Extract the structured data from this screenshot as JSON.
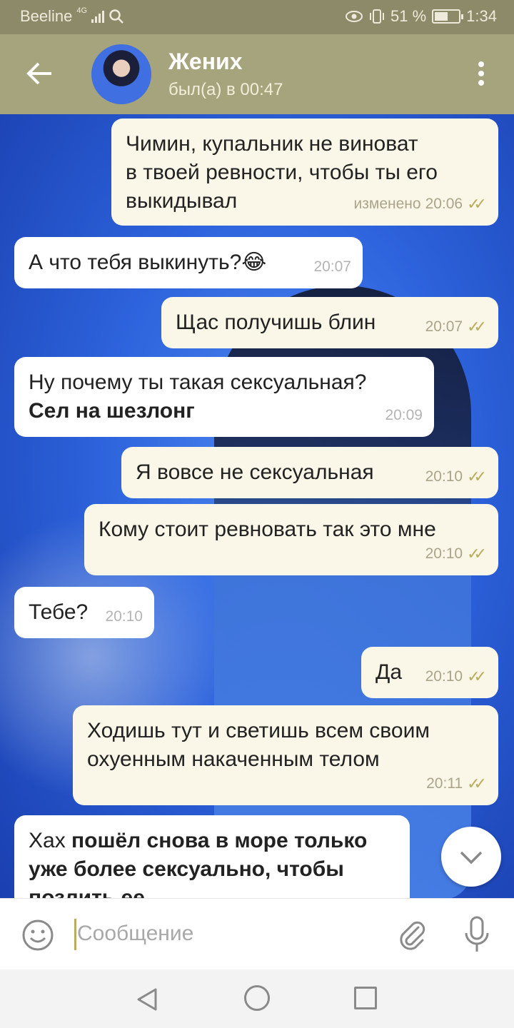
{
  "status_bar": {
    "carrier": "Beeline",
    "network": "4G",
    "battery": "51 %",
    "time": "1:34"
  },
  "header": {
    "contact_name": "Жених",
    "last_seen": "был(а) в 00:47"
  },
  "messages": [
    {
      "dir": "out",
      "lines": [
        "Чимин, купальник не виноват",
        "в твоей ревности, чтобы ты его",
        "выкидывал"
      ],
      "edited": "изменено",
      "time": "20:06",
      "read": true
    },
    {
      "dir": "in",
      "text": "А что тебя выкинуть?😂",
      "time": "20:07"
    },
    {
      "dir": "out",
      "text": "Щас получишь блин",
      "time": "20:07",
      "read": true
    },
    {
      "dir": "in",
      "text": "Ну почему ты такая сексуальная?",
      "bold_text": "Сел на шезлонг",
      "time": "20:09"
    },
    {
      "dir": "out",
      "text": "Я вовсе не сексуальная",
      "time": "20:10",
      "read": true
    },
    {
      "dir": "out",
      "text": "Кому стоит ревновать так это мне",
      "time": "20:10",
      "read": true
    },
    {
      "dir": "in",
      "text": "Тебе?",
      "time": "20:10"
    },
    {
      "dir": "out",
      "text": "Да",
      "time": "20:10",
      "read": true
    },
    {
      "dir": "out",
      "lines": [
        "Ходишь тут и светишь всем своим",
        "охуенным накаченным телом"
      ],
      "time": "20:11",
      "read": true
    },
    {
      "dir": "in",
      "prefix": "Хах ",
      "bold_lines": [
        "пошёл снова в море только",
        "уже более сексуально, чтобы",
        "позлить ее"
      ]
    }
  ],
  "composer": {
    "placeholder": "Сообщение"
  },
  "icons": [
    "back-arrow-icon",
    "menu-icon",
    "emoji-icon",
    "attach-icon",
    "mic-icon",
    "scroll-down-icon",
    "nav-back-icon",
    "nav-home-icon",
    "nav-recent-icon"
  ],
  "colors": {
    "header": "#a6a47c",
    "outgoing_bubble": "#fbf7e8",
    "incoming_bubble": "#ffffff",
    "ticks": "#b9ac5c"
  }
}
